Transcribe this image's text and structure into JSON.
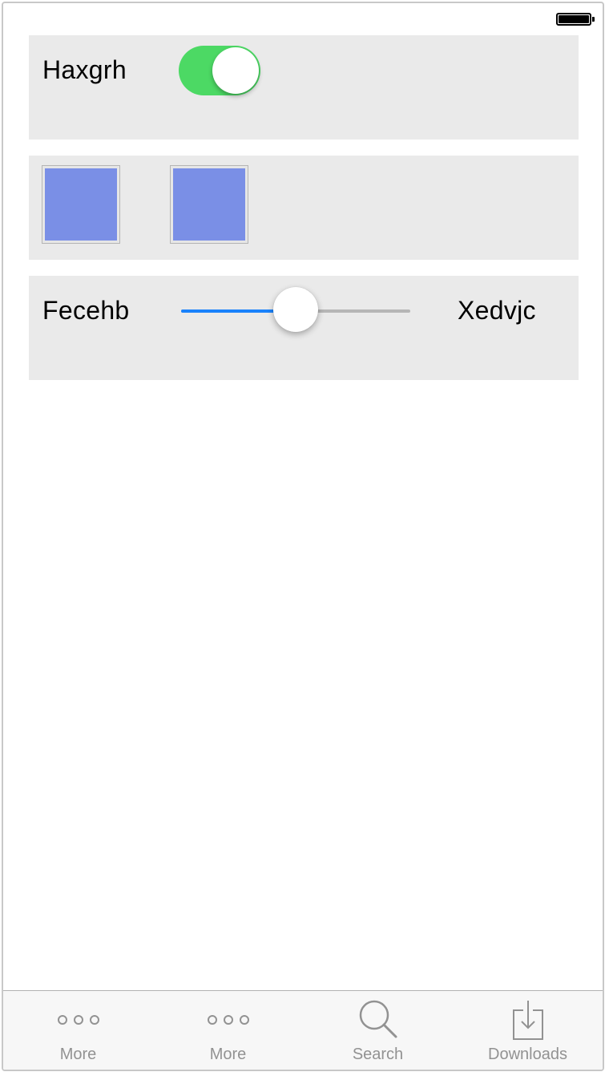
{
  "status_bar": {
    "battery_icon": "battery-full-icon"
  },
  "switch_row": {
    "label": "Haxgrh",
    "on": true,
    "on_color": "#4cd964"
  },
  "swatch_row": {
    "swatches": [
      {
        "color": "#7a8fe6"
      },
      {
        "color": "#7a8fe6"
      }
    ]
  },
  "slider_row": {
    "min_label": "Fecehb",
    "max_label": "Xedvjc",
    "value_fraction": 0.5,
    "track_fill_color": "#1a82fb"
  },
  "tab_bar": {
    "tabs": [
      {
        "label": "More",
        "icon": "more-icon"
      },
      {
        "label": "More",
        "icon": "more-icon"
      },
      {
        "label": "Search",
        "icon": "search-icon"
      },
      {
        "label": "Downloads",
        "icon": "downloads-icon"
      }
    ]
  }
}
